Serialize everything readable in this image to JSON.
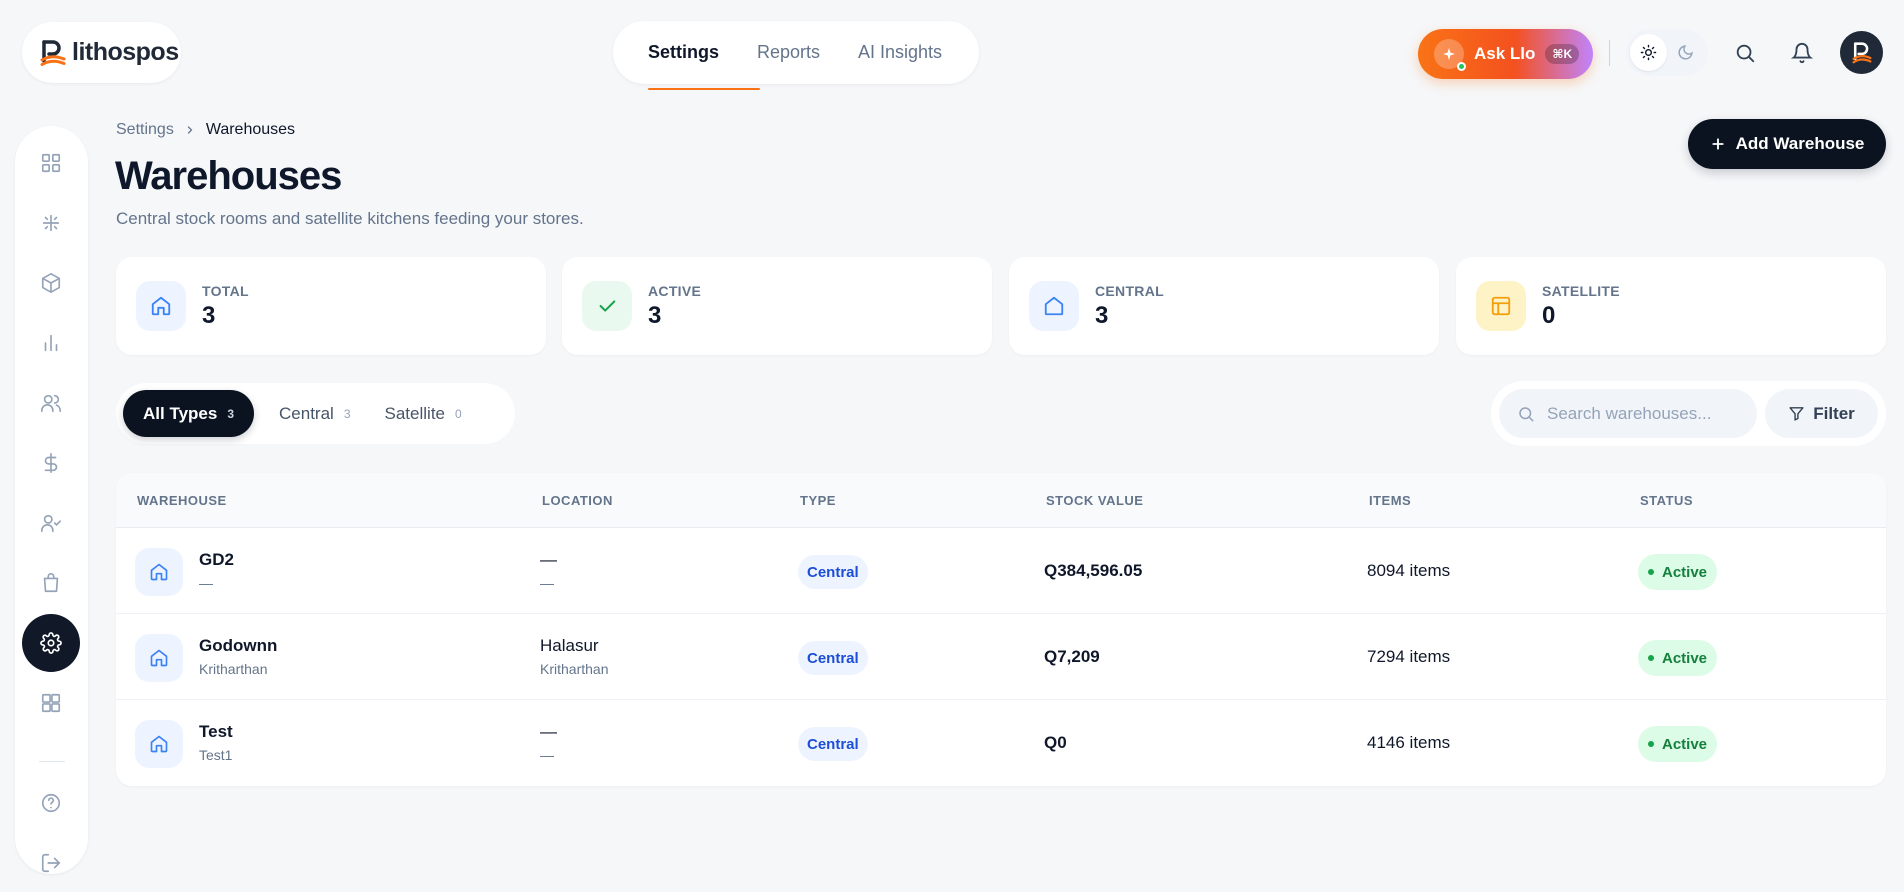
{
  "brand": {
    "name": "lithospos"
  },
  "topnav": {
    "tabs": [
      {
        "label": "Settings",
        "active": true
      },
      {
        "label": "Reports",
        "active": false
      },
      {
        "label": "AI Insights",
        "active": false
      }
    ]
  },
  "assistant": {
    "label": "Ask Llo",
    "shortcut": "⌘K"
  },
  "theme": {
    "selected": "light"
  },
  "sidebar": {
    "items": [
      {
        "icon": "dashboard-grid-icon",
        "active": false
      },
      {
        "icon": "sparkle-grid-icon",
        "active": false
      },
      {
        "icon": "box-icon",
        "active": false
      },
      {
        "icon": "bar-chart-icon",
        "active": false
      },
      {
        "icon": "users-icon",
        "active": false
      },
      {
        "icon": "dollar-icon",
        "active": false
      },
      {
        "icon": "user-check-icon",
        "active": false
      },
      {
        "icon": "shopping-bag-icon",
        "active": false
      },
      {
        "icon": "gear-icon",
        "active": true
      },
      {
        "icon": "apps-grid-icon",
        "active": false
      }
    ],
    "bottom": [
      {
        "icon": "help-circle-icon"
      },
      {
        "icon": "logout-icon"
      }
    ]
  },
  "breadcrumb": {
    "parent": "Settings",
    "current": "Warehouses"
  },
  "page": {
    "title": "Warehouses",
    "subtitle": "Central stock rooms and satellite kitchens feeding your stores.",
    "add_button": "Add Warehouse"
  },
  "stats": [
    {
      "label": "TOTAL",
      "value": "3",
      "icon": "home-icon",
      "bg": "#eef4ff",
      "color": "#3b82f6"
    },
    {
      "label": "ACTIVE",
      "value": "3",
      "icon": "check-icon",
      "bg": "#e9f9ef",
      "color": "#16a34a"
    },
    {
      "label": "CENTRAL",
      "value": "3",
      "icon": "house-icon",
      "bg": "#eef4ff",
      "color": "#3b82f6"
    },
    {
      "label": "SATELLITE",
      "value": "0",
      "icon": "layout-icon",
      "bg": "#fef3c7",
      "color": "#f59e0b"
    }
  ],
  "type_tabs": [
    {
      "label": "All Types",
      "count": "3",
      "active": true
    },
    {
      "label": "Central",
      "count": "3",
      "active": false
    },
    {
      "label": "Satellite",
      "count": "0",
      "active": false
    }
  ],
  "search": {
    "placeholder": "Search warehouses...",
    "value": ""
  },
  "filter": {
    "label": "Filter"
  },
  "table": {
    "columns": [
      "WAREHOUSE",
      "LOCATION",
      "TYPE",
      "STOCK VALUE",
      "ITEMS",
      "STATUS"
    ],
    "rows": [
      {
        "name": "GD2",
        "sub": "—",
        "location": "—",
        "location_sub": "—",
        "type": "Central",
        "stock_value": "Q384,596.05",
        "items": "8094 items",
        "status": "Active"
      },
      {
        "name": "Godownn",
        "sub": "Kritharthan",
        "location": "Halasur",
        "location_sub": "Kritharthan",
        "type": "Central",
        "stock_value": "Q7,209",
        "items": "7294 items",
        "status": "Active"
      },
      {
        "name": "Test",
        "sub": "Test1",
        "location": "—",
        "location_sub": "—",
        "type": "Central",
        "stock_value": "Q0",
        "items": "4146 items",
        "status": "Active"
      }
    ]
  },
  "colors": {
    "accent": "#f97316",
    "dark": "#0b1220",
    "status_active": "#15803d"
  }
}
